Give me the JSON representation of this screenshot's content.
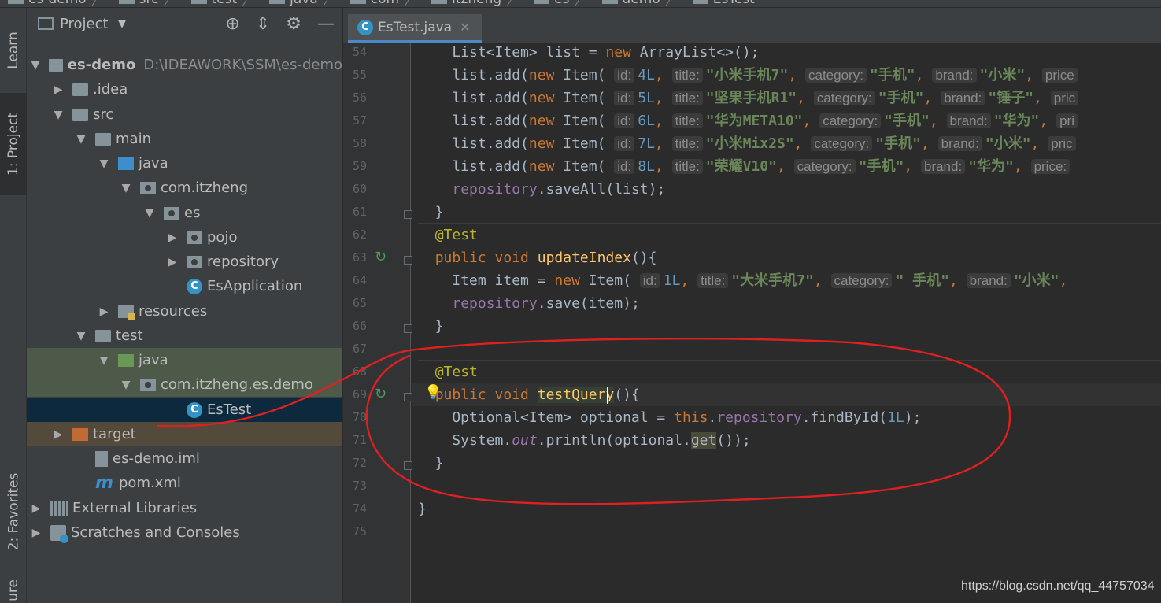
{
  "breadcrumb": [
    "es-demo",
    "src",
    "test",
    "java",
    "com",
    "itzheng",
    "es",
    "demo",
    "EsTest"
  ],
  "left_strip": {
    "learn": "Learn",
    "project": "1: Project",
    "favorites": "2: Favorites",
    "structure": "ure"
  },
  "project_panel": {
    "title": "Project",
    "dropdown_icon": "chevron-down-icon",
    "header_icons": [
      "crosshair-icon",
      "collapse-all-icon",
      "gear-icon",
      "hide-icon"
    ],
    "tree": [
      {
        "label": "es-demo",
        "path": "D:\\IDEAWORK\\SSM\\es-demo",
        "icon": "module-folder-icon",
        "expanded": true
      },
      {
        "label": ".idea",
        "icon": "folder-icon",
        "expanded": false
      },
      {
        "label": "src",
        "icon": "folder-icon",
        "expanded": true
      },
      {
        "label": "main",
        "icon": "folder-icon",
        "expanded": true
      },
      {
        "label": "java",
        "icon": "source-folder-icon",
        "expanded": true
      },
      {
        "label": "com.itzheng",
        "icon": "package-icon",
        "expanded": true
      },
      {
        "label": "es",
        "icon": "package-icon",
        "expanded": true
      },
      {
        "label": "pojo",
        "icon": "package-icon",
        "expanded": false
      },
      {
        "label": "repository",
        "icon": "package-icon",
        "expanded": false
      },
      {
        "label": "EsApplication",
        "icon": "spring-class-icon"
      },
      {
        "label": "resources",
        "icon": "resources-folder-icon",
        "expanded": false
      },
      {
        "label": "test",
        "icon": "folder-icon",
        "expanded": true
      },
      {
        "label": "java",
        "icon": "test-folder-icon",
        "expanded": true
      },
      {
        "label": "com.itzheng.es.demo",
        "icon": "package-icon",
        "expanded": true
      },
      {
        "label": "EsTest",
        "icon": "class-icon",
        "selected": true
      },
      {
        "label": "target",
        "icon": "excluded-folder-icon",
        "expanded": false
      },
      {
        "label": "es-demo.iml",
        "icon": "iml-file-icon"
      },
      {
        "label": "pom.xml",
        "icon": "maven-icon"
      },
      {
        "label": "External Libraries",
        "icon": "libraries-icon",
        "expanded": false
      },
      {
        "label": "Scratches and Consoles",
        "icon": "scratches-icon",
        "expanded": false
      }
    ]
  },
  "editor": {
    "tab": {
      "label": "EsTest.java",
      "close": "✕"
    },
    "line_numbers": [
      "54",
      "55",
      "56",
      "57",
      "58",
      "59",
      "60",
      "61",
      "62",
      "63",
      "64",
      "65",
      "66",
      "67",
      "68",
      "69",
      "70",
      "71",
      "72",
      "73",
      "74",
      "75"
    ],
    "code": {
      "l54": "List<Item> list = new ArrayList<>();",
      "l55": {
        "pre": "list.add(",
        "new": "new",
        "cls": " Item( ",
        "id_hint": "id:",
        "id": "4L",
        "title_hint": "title:",
        "title": "\"小米手机7\"",
        "cat_hint": "category:",
        "cat": "\"手机\"",
        "brand_hint": "brand:",
        "brand": "\"小米\"",
        "price_hint": "price"
      },
      "l56": {
        "pre": "list.add(",
        "new": "new",
        "cls": " Item( ",
        "id_hint": "id:",
        "id": "5L",
        "title_hint": "title:",
        "title": "\"坚果手机R1\"",
        "cat_hint": "category:",
        "cat": "\"手机\"",
        "brand_hint": "brand:",
        "brand": "\"锤子\"",
        "price_hint": "pric"
      },
      "l57": {
        "pre": "list.add(",
        "new": "new",
        "cls": " Item( ",
        "id_hint": "id:",
        "id": "6L",
        "title_hint": "title:",
        "title": "\"华为META10\"",
        "cat_hint": "category:",
        "cat": "\"手机\"",
        "brand_hint": "brand:",
        "brand": "\"华为\"",
        "price_hint": "pri"
      },
      "l58": {
        "pre": "list.add(",
        "new": "new",
        "cls": " Item( ",
        "id_hint": "id:",
        "id": "7L",
        "title_hint": "title:",
        "title": "\"小米Mix2S\"",
        "cat_hint": "category:",
        "cat": "\"手机\"",
        "brand_hint": "brand:",
        "brand": "\"小米\"",
        "price_hint": "pric"
      },
      "l59": {
        "pre": "list.add(",
        "new": "new",
        "cls": " Item( ",
        "id_hint": "id:",
        "id": "8L",
        "title_hint": "title:",
        "title": "\"荣耀V10\"",
        "cat_hint": "category:",
        "cat": "\"手机\"",
        "brand_hint": "brand:",
        "brand": "\"华为\"",
        "price_hint": "price:"
      },
      "l60": {
        "obj": "repository",
        "rest": ".saveAll(list);"
      },
      "l61": "}",
      "l62": "@Test",
      "l63": {
        "kw": "public void",
        "fn": "updateIndex",
        "rest": "(){"
      },
      "l64": {
        "pre": "Item item = ",
        "new": "new",
        "cls": " Item( ",
        "id_hint": "id:",
        "id": "1L",
        "title_hint": "title:",
        "title": "\"大米手机7\"",
        "cat_hint": "category:",
        "cat": "\" 手机\"",
        "brand_hint": "brand:",
        "brand": "\"小米\""
      },
      "l65": {
        "obj": "repository",
        "rest": ".save(item);"
      },
      "l66": "}",
      "l68": "@Test",
      "l69": {
        "kw": "public void",
        "fn": "testQuery",
        "rest": "(){"
      },
      "l70": {
        "pre": "Optional<Item> optional = ",
        "this": "this",
        "dot": ".",
        "obj": "repository",
        "call": ".findById(",
        "num": "1L",
        "end": ");"
      },
      "l71": {
        "pre": "System.",
        "out": "out",
        "mid": ".println(optional.",
        "get": "get",
        "end": "());"
      },
      "l72": "}",
      "l74": "}"
    }
  },
  "watermark": "https://blog.csdn.net/qq_44757034"
}
